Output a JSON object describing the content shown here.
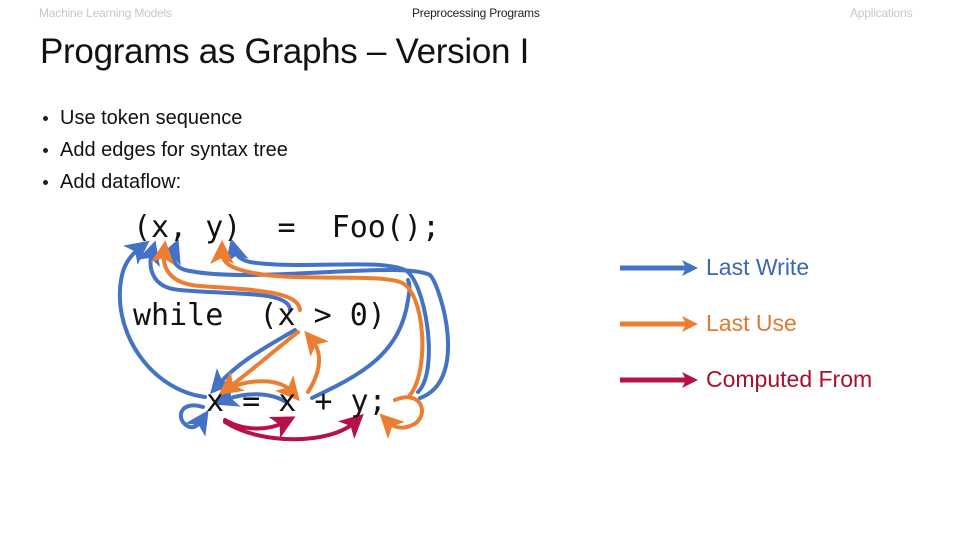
{
  "nav": {
    "items": [
      {
        "label": "Machine Learning Models",
        "active": false
      },
      {
        "label": "Preprocessing Programs",
        "active": true
      },
      {
        "label": "Applications",
        "active": false
      }
    ]
  },
  "title": "Programs as Graphs – Version I",
  "bullets": [
    "Use token sequence",
    "Add edges for syntax tree",
    "Add dataflow:"
  ],
  "code": {
    "line1": "(x, y)  =  Foo();",
    "line2": "while  (x > 0)",
    "line3": "x = x + y;"
  },
  "legend": [
    {
      "label": "Last Write",
      "color": "#4472c4",
      "text_color": "#3d67b0"
    },
    {
      "label": "Last Use",
      "color": "#ed7d31",
      "text_color": "#e07a30"
    },
    {
      "label": "Computed From",
      "color": "#b5124c",
      "text_color": "#a5122c"
    }
  ],
  "colors": {
    "last_write": "#4472c4",
    "last_use": "#ed7d31",
    "computed_from": "#b5124c"
  }
}
